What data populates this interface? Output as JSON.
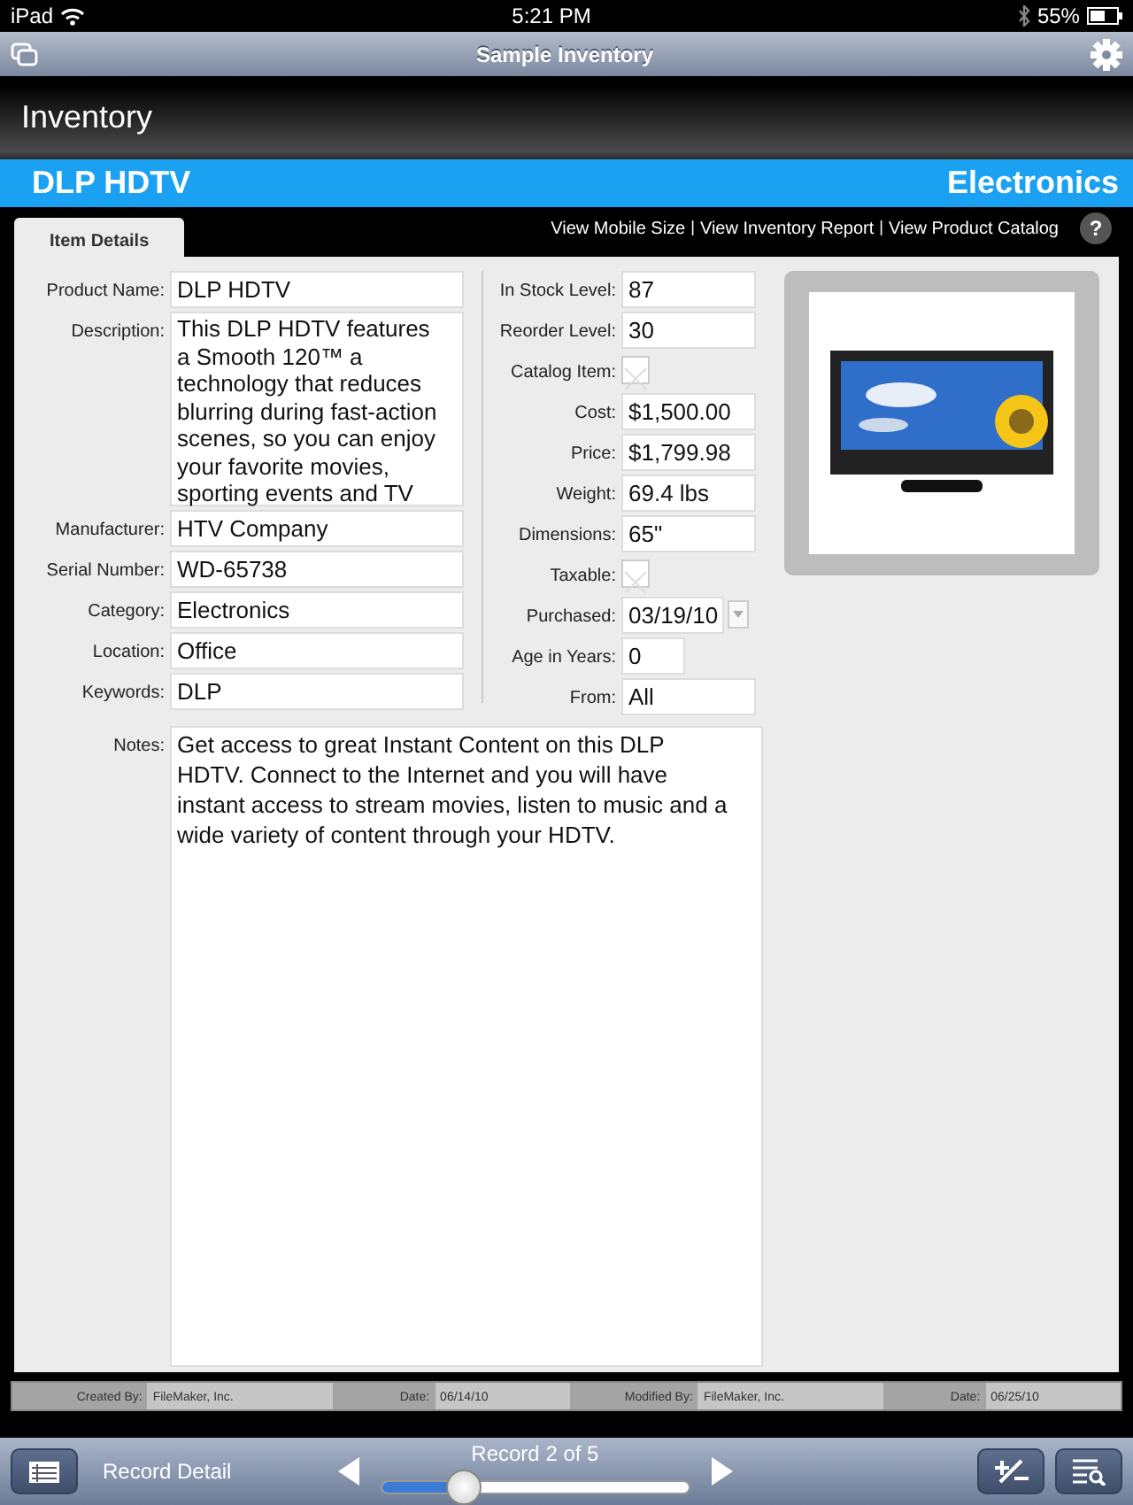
{
  "status_bar": {
    "carrier": "iPad",
    "time": "5:21 PM",
    "battery": "55%"
  },
  "nav_bar": {
    "title": "Sample Inventory"
  },
  "header": {
    "title": "Inventory"
  },
  "record_band": {
    "name": "DLP HDTV",
    "category": "Electronics"
  },
  "tabs": [
    {
      "label": "Item Details",
      "selected": true
    }
  ],
  "links": [
    {
      "kind": "link",
      "label": "View Mobile Size"
    },
    {
      "kind": "separator",
      "label": "|"
    },
    {
      "kind": "link",
      "label": "View Inventory Report"
    },
    {
      "kind": "separator",
      "label": "|"
    },
    {
      "kind": "link",
      "label": "View Product Catalog"
    }
  ],
  "help_button": "?",
  "left_fields": [
    {
      "kind": "text",
      "label": "Product Name:",
      "value": "DLP HDTV"
    },
    {
      "kind": "textarea",
      "label": "Description:",
      "value": "This DLP HDTV features a Smooth 120™ a technology that reduces blurring during fast-action scenes, so you can enjoy your favorite movies, sporting events and TV"
    },
    {
      "kind": "text",
      "label": "Manufacturer:",
      "value": "HTV Company"
    },
    {
      "kind": "text",
      "label": "Serial Number:",
      "value": "WD-65738"
    },
    {
      "kind": "text",
      "label": "Category:",
      "value": "Electronics"
    },
    {
      "kind": "text",
      "label": "Location:",
      "value": "Office"
    },
    {
      "kind": "text",
      "label": "Keywords:",
      "value": "DLP"
    }
  ],
  "right_fields": [
    {
      "kind": "text",
      "label": "In Stock Level:",
      "value": "87"
    },
    {
      "kind": "text",
      "label": "Reorder Level:",
      "value": "30"
    },
    {
      "kind": "checkbox",
      "label": "Catalog Item:",
      "checked": false
    },
    {
      "kind": "text",
      "label": "Cost:",
      "value": "$1,500.00"
    },
    {
      "kind": "text",
      "label": "Price:",
      "value": "$1,799.98"
    },
    {
      "kind": "text",
      "label": "Weight:",
      "value": "69.4 lbs"
    },
    {
      "kind": "text",
      "label": "Dimensions:",
      "value": "65\""
    },
    {
      "kind": "checkbox",
      "label": "Taxable:",
      "checked": false
    },
    {
      "kind": "date",
      "label": "Purchased:",
      "value": "03/19/10"
    },
    {
      "kind": "short",
      "label": "Age in Years:",
      "value": "0"
    },
    {
      "kind": "text",
      "label": "From:",
      "value": "All"
    }
  ],
  "notes": {
    "label": "Notes:",
    "value": "Get access to great Instant Content on this DLP HDTV. Connect to the Internet and you will have instant access to stream movies, listen to music and a wide variety of content through your HDTV."
  },
  "footer_fields": [
    {
      "label": "Created By:",
      "value": "FileMaker, Inc."
    },
    {
      "label": "Date:",
      "value": "06/14/10"
    },
    {
      "label": "Modified By:",
      "value": "FileMaker, Inc."
    },
    {
      "label": "Date:",
      "value": "06/25/10"
    }
  ],
  "toolbar": {
    "layout_name": "Record Detail",
    "record_label": "Record 2 of 5",
    "level": 0.27
  }
}
